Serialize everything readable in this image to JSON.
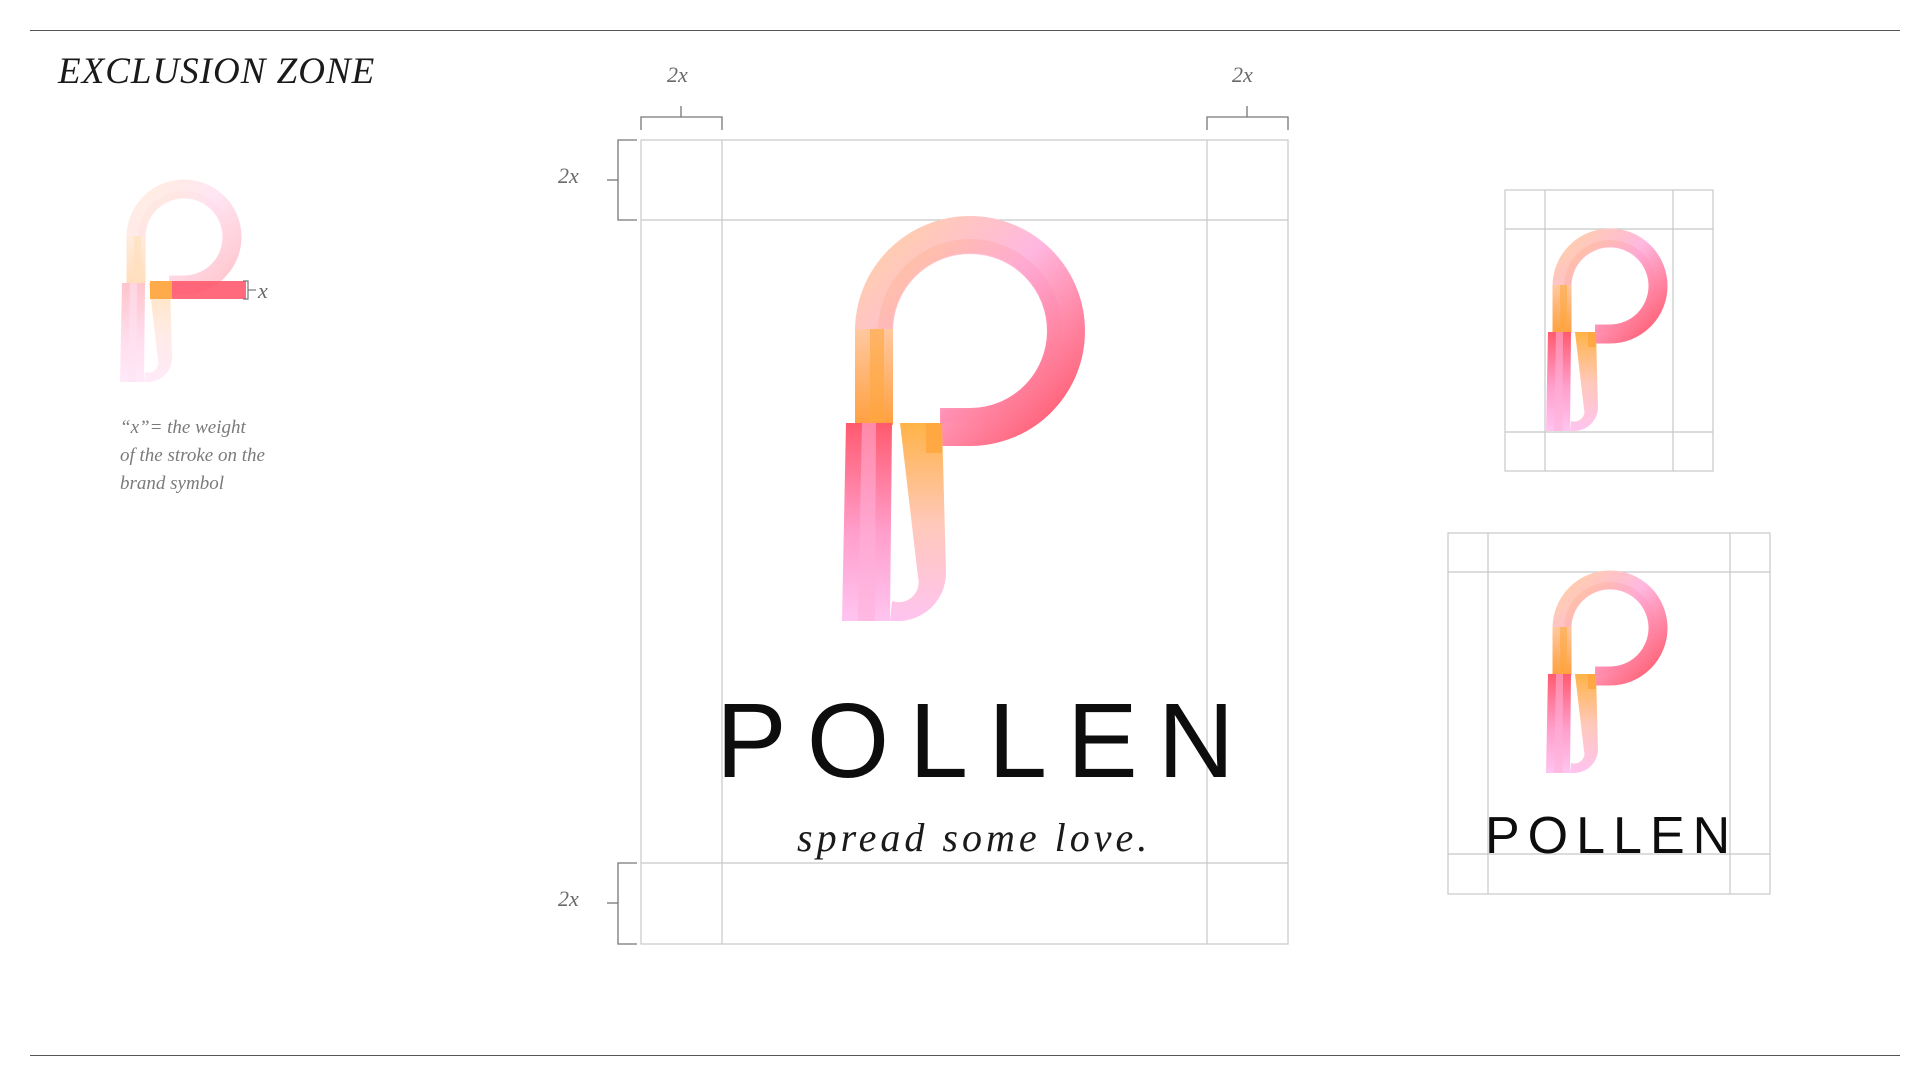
{
  "page": {
    "title": "EXCLUSION ZONE"
  },
  "legend": {
    "x_label": "x",
    "caption_lines": [
      "“x”= the weight",
      "of the stroke on the",
      "brand symbol"
    ]
  },
  "main_lockup": {
    "label_top_left": "2x",
    "label_top_right": "2x",
    "label_left_top": "2x",
    "label_left_bottom": "2x",
    "wordmark": "POLLEN",
    "tagline": "spread some love."
  },
  "small_lockup": {
    "wordmark": "POLLEN"
  },
  "colors": {
    "coral": "#ff5a6e",
    "orange": "#ffb347",
    "pink": "#ff9ecb",
    "lilac": "#ffc4f0",
    "guide": "#c8c8c8",
    "text": "#0d0d0d"
  },
  "icons": [
    "pollen-p-symbol"
  ]
}
